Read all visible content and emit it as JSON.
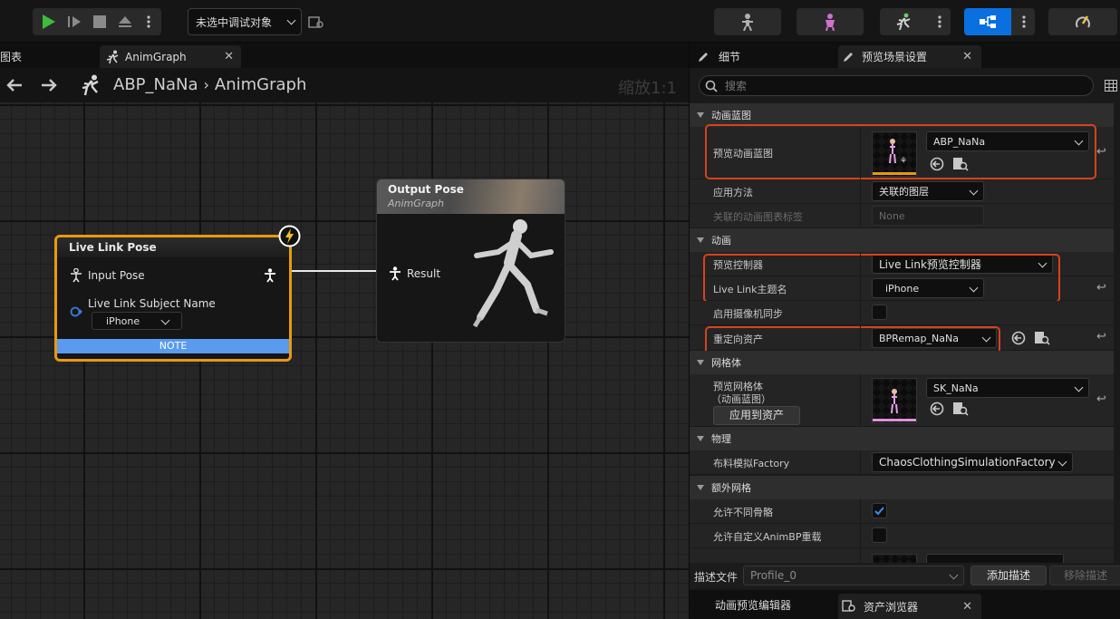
{
  "toolbar": {
    "debug_target": "未选中调试对象",
    "colors": {
      "play": "#3dbb3d",
      "active_mode": "#0a70e0"
    }
  },
  "graph_tabs": {
    "left_partial": "图表",
    "active": "AnimGraph"
  },
  "breadcrumb": {
    "asset": "ABP_NaNa",
    "graph": "AnimGraph",
    "zoom": "缩放1:1"
  },
  "nodes": {
    "live_link": {
      "title": "Live Link Pose",
      "input_pose": "Input Pose",
      "subject_label": "Live Link Subject Name",
      "subject_value": "iPhone",
      "note": "NOTE"
    },
    "output": {
      "title": "Output Pose",
      "subtitle": "AnimGraph",
      "result": "Result"
    }
  },
  "details": {
    "tab_details": "细节",
    "tab_preview": "预览场景设置",
    "search_placeholder": "搜索",
    "sections": {
      "anim_bp": "动画蓝图",
      "animation": "动画",
      "mesh": "网格体",
      "physics": "物理",
      "extra_mesh": "额外网格"
    },
    "rows": {
      "preview_bp_label": "预览动画蓝图",
      "preview_bp_value": "ABP_NaNa",
      "apply_method_label": "应用方法",
      "apply_method_value": "关联的图层",
      "linked_tag_label": "关联的动画图表标签",
      "linked_tag_value": "None",
      "preview_ctrl_label": "预览控制器",
      "preview_ctrl_value": "Live Link预览控制器",
      "subject_label": "Live Link主题名",
      "subject_value": "iPhone",
      "camera_sync_label": "启用摄像机同步",
      "retarget_label": "重定向资产",
      "retarget_value": "BPRemap_NaNa",
      "preview_mesh_label": "预览网格体",
      "preview_mesh_label2": "（动画蓝图）",
      "preview_mesh_value": "SK_NaNa",
      "apply_to_asset": "应用到资产",
      "cloth_label": "布料模拟Factory",
      "cloth_value": "ChaosClothingSimulationFactory",
      "allow_diff_label": "允许不同骨骼",
      "allow_custom_label": "允许自定义AnimBP重载"
    },
    "profile_label": "描述文件",
    "profile_value": "Profile_0",
    "add_profile": "添加描述",
    "remove_profile": "移除描述"
  },
  "bottom_tabs": {
    "anim_preview": "动画预览编辑器",
    "asset_browser": "资产浏览器"
  }
}
